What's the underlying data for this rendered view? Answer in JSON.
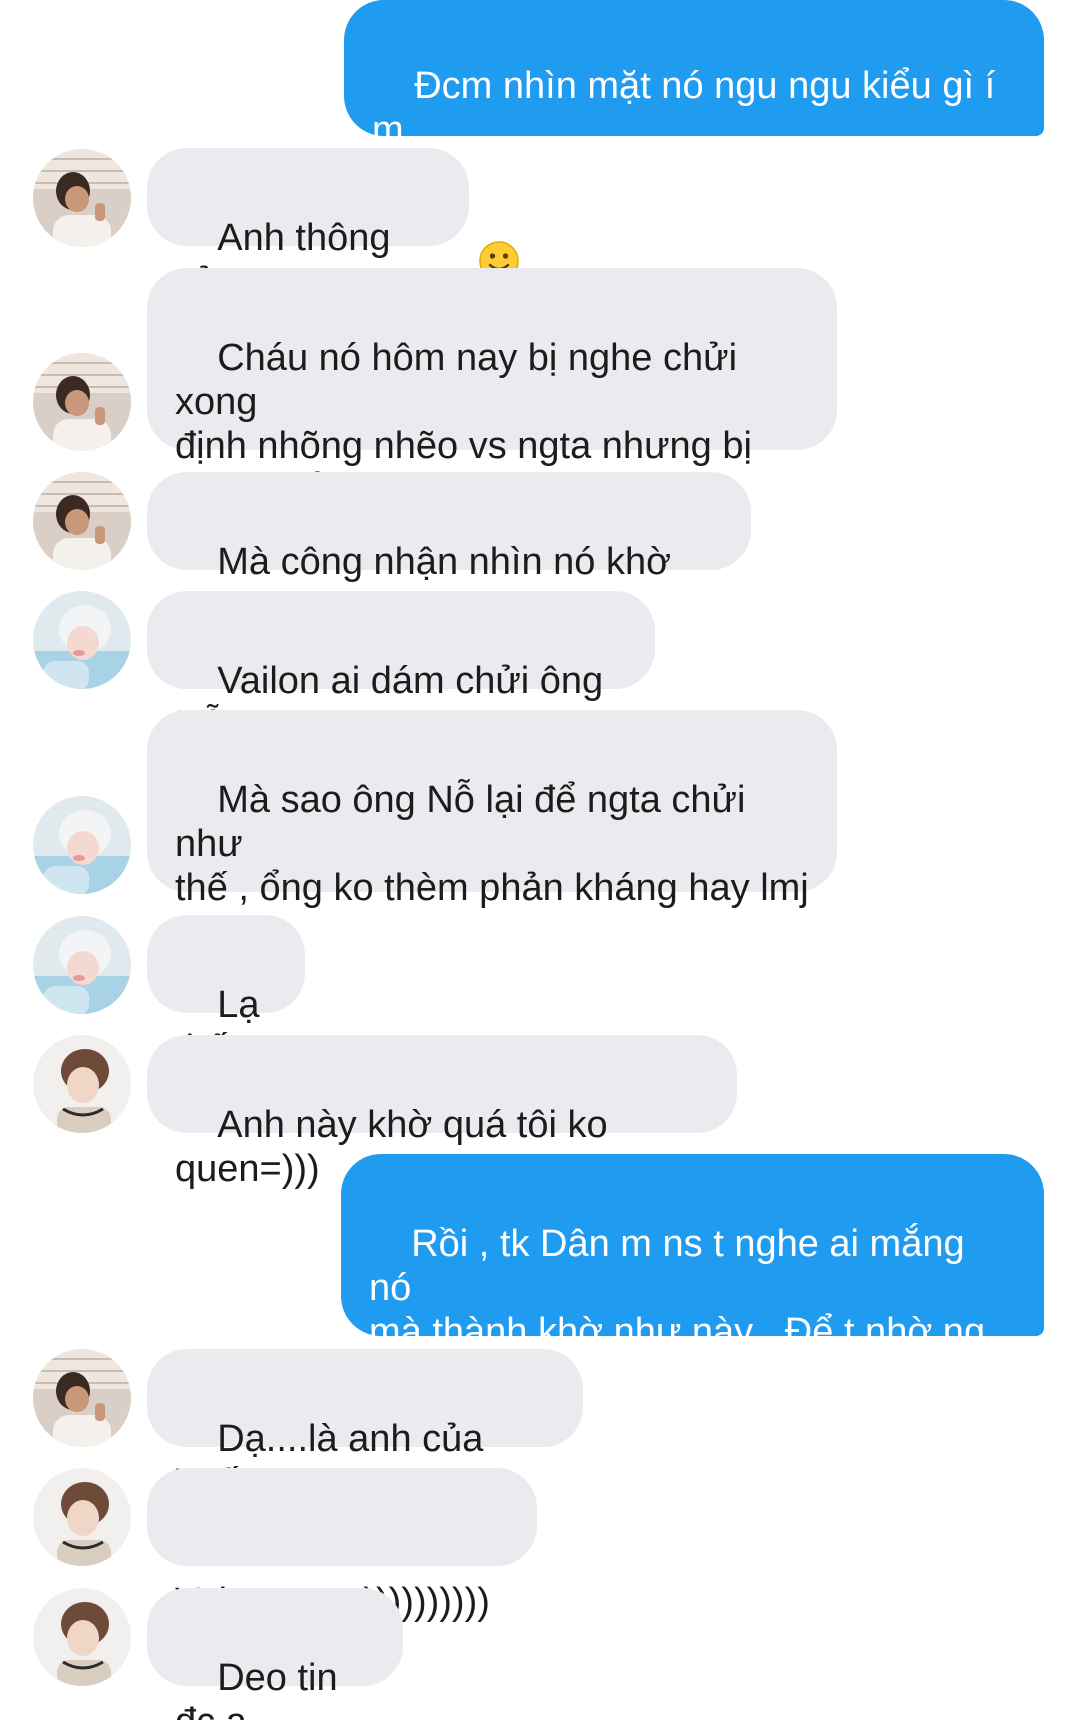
{
  "messages": [
    {
      "sender": "me",
      "text": "Đcm nhìn mặt nó ngu ngu kiểu gì í m",
      "emoji": "slightly-smiling-face-icon"
    },
    {
      "sender": "A",
      "text": "Anh thông cảm"
    },
    {
      "sender": "A",
      "text": "Cháu nó hôm nay bị nghe chửi xong\nđịnh nhõng nhẽo vs ngta nhưng bị\nngta đuổi đi"
    },
    {
      "sender": "A",
      "text": "Mà công nhận nhìn nó khờ vãi",
      "emoji": "slightly-smiling-face-icon"
    },
    {
      "sender": "B",
      "text": "Vailon ai dám chửi ông Nỗ"
    },
    {
      "sender": "B",
      "text": "Mà sao ông Nỗ lại để ngta chửi như\nthế , ổng ko thèm phản kháng hay lmj\nà"
    },
    {
      "sender": "B",
      "text": "Lạ thế"
    },
    {
      "sender": "C",
      "text": "Anh này khờ quá tôi ko quen=)))"
    },
    {
      "sender": "me",
      "text": "Rồi , tk Dân m ns t nghe ai mắng nó\nmà thành khờ như này . Để t nhờ ng\nđó truyền bí kíp cho t"
    },
    {
      "sender": "A",
      "text": "Dạ....là anh của Tuấn ạ"
    },
    {
      "sender": "C",
      "text": "Vaicameo=))))))))))"
    },
    {
      "sender": "C",
      "text": "Deo tin đc ạ"
    }
  ],
  "colors": {
    "outgoing_bubble": "#1f9bf0",
    "incoming_bubble": "#e9ebee",
    "incoming_text": "#1c1c1c",
    "outgoing_text": "#ffffff"
  }
}
